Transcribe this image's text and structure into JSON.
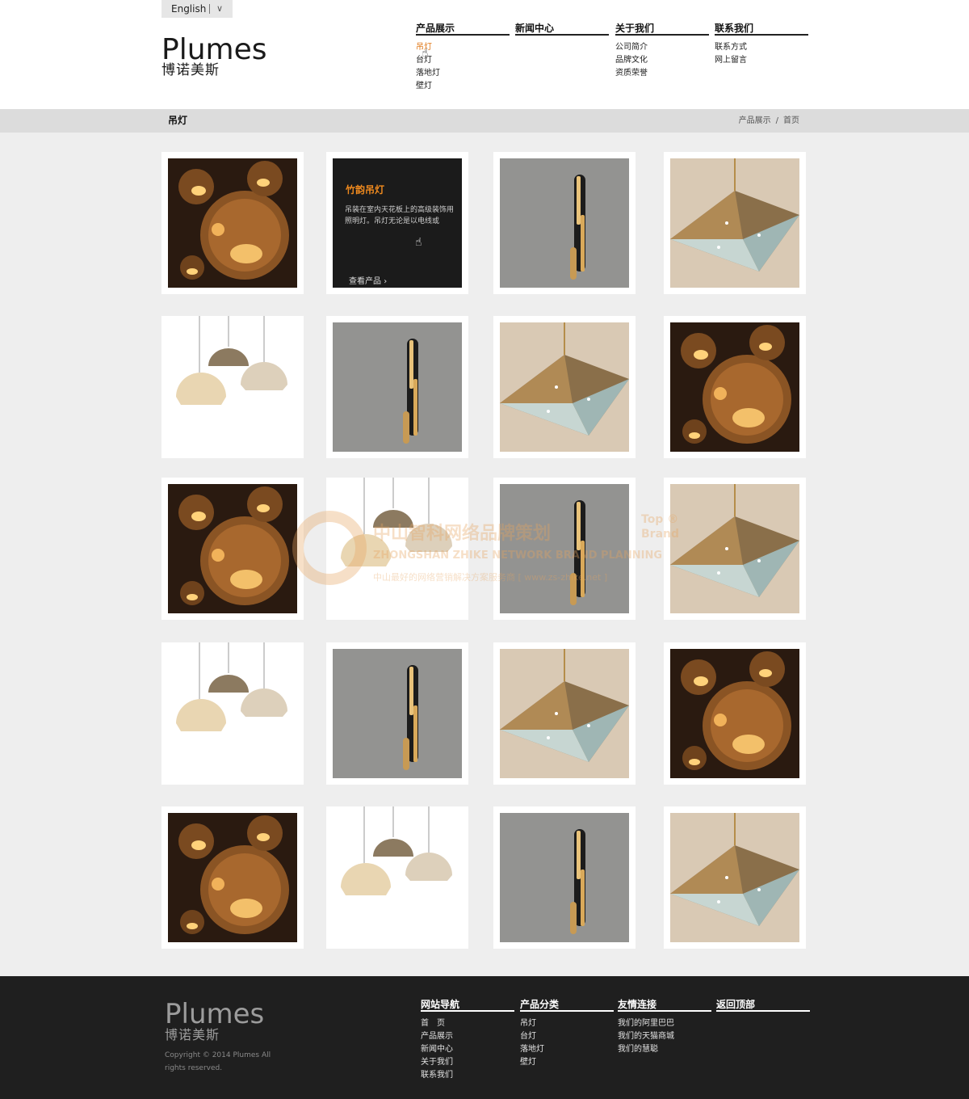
{
  "header": {
    "language": "English",
    "logo_en": "Plumes",
    "logo_cn": "博诺美斯",
    "nav": [
      {
        "title": "产品展示",
        "items": [
          "吊灯",
          "台灯",
          "落地灯",
          "壁灯"
        ]
      },
      {
        "title": "新闻中心",
        "items": []
      },
      {
        "title": "关于我们",
        "items": [
          "公司简介",
          "品牌文化",
          "资质荣誉"
        ]
      },
      {
        "title": "联系我们",
        "items": [
          "联系方式",
          "网上留言"
        ]
      }
    ]
  },
  "page_bar": {
    "title": "吊灯",
    "breadcrumb": [
      "产品展示",
      "/",
      "首页"
    ]
  },
  "hover_card": {
    "title": "竹韵吊灯",
    "description": "吊装在室内天花板上的高级装饰用照明灯。吊灯无论是以电线或",
    "more": "查看产品",
    "more_arrow": "›"
  },
  "watermark": {
    "line1": "中山智科网络品牌策划",
    "line2": "ZHONGSHAN ZHIKE NETWORK BRAND PLANNING",
    "line3": "中山最好的网络营销解决方案服务商 [ www.zs-zhike.net ]",
    "badge": "Top ® Brand"
  },
  "products": {
    "rows": [
      [
        "scraplight",
        "hover",
        "tube",
        "crystal"
      ],
      [
        "shades",
        "tube",
        "crystal",
        "scraplight"
      ],
      [
        "scraplight",
        "shades",
        "tube",
        "crystal"
      ],
      [
        "shades",
        "tube",
        "crystal",
        "scraplight"
      ],
      [
        "scraplight",
        "shades",
        "tube",
        "crystal"
      ]
    ]
  },
  "footer": {
    "logo_en": "Plumes",
    "logo_cn": "博诺美斯",
    "copyright": "Copyright © 2014 Plumes  All rights reserved.",
    "columns": [
      {
        "title": "网站导航",
        "items": [
          "首　页",
          "产品展示",
          "新闻中心",
          "关于我们",
          "联系我们"
        ]
      },
      {
        "title": "产品分类",
        "items": [
          "吊灯",
          "台灯",
          "落地灯",
          "壁灯"
        ]
      },
      {
        "title": "友情连接",
        "items": [
          "我们的阿里巴巴",
          "我们的天猫商城",
          "我们的慧聪"
        ]
      },
      {
        "title": "返回顶部",
        "items": []
      }
    ]
  },
  "colors": {
    "accent": "#e07a1c",
    "footer_bg": "#1f1f1f",
    "bar_bg": "#dcdcdc",
    "page_bg": "#eeeeee"
  }
}
